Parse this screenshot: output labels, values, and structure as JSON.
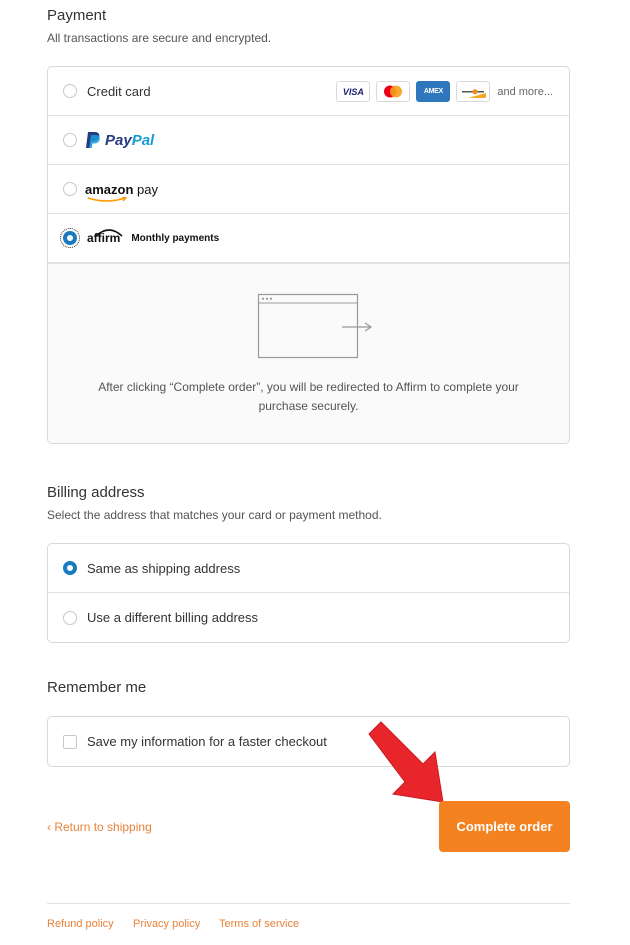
{
  "payment": {
    "title": "Payment",
    "subtitle": "All transactions are secure and encrypted.",
    "methods": [
      {
        "label": "Credit card",
        "selected": false
      },
      {
        "label": "PayPal",
        "selected": false
      },
      {
        "label": "amazon pay",
        "selected": false
      },
      {
        "label": "affirm",
        "sublabel": "Monthly payments",
        "selected": true
      }
    ],
    "card_brands": [
      "VISA",
      "mastercard",
      "AMEX",
      "discover"
    ],
    "card_brand_visa": "VISA",
    "card_brand_amex": "AMEX",
    "more_label": "and more...",
    "paypal_part1": "Pay",
    "paypal_part2": "Pal",
    "amazon_part1": "amazon",
    "amazon_part2": " pay",
    "redirect_text": "After clicking “Complete order”, you will be redirected to Affirm to complete your purchase securely."
  },
  "billing": {
    "title": "Billing address",
    "subtitle": "Select the address that matches your card or payment method.",
    "options": [
      {
        "label": "Same as shipping address",
        "selected": true
      },
      {
        "label": "Use a different billing address",
        "selected": false
      }
    ]
  },
  "remember": {
    "title": "Remember me",
    "checkbox_label": "Save my information for a faster checkout",
    "checked": false
  },
  "actions": {
    "back_label": "Return to shipping",
    "complete_label": "Complete order"
  },
  "footer": {
    "links": [
      "Refund policy",
      "Privacy policy",
      "Terms of service"
    ]
  },
  "colors": {
    "accent": "#f58220",
    "link": "#e8823a",
    "radio_selected": "#197bbd",
    "arrow": "#e8252b"
  }
}
